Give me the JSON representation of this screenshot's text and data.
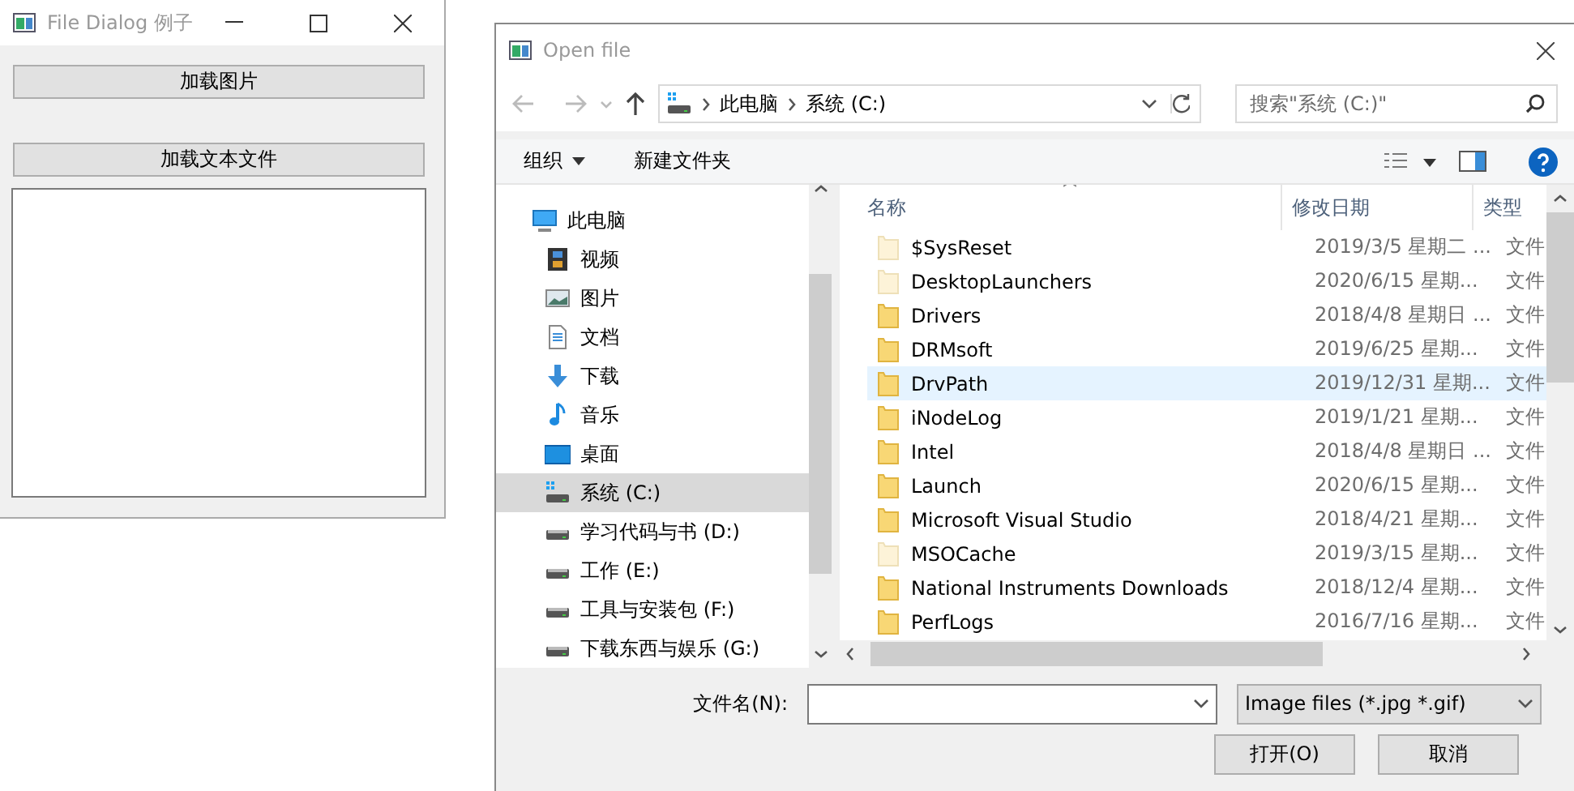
{
  "main_window": {
    "title": "File Dialog 例子",
    "buttons": [
      "加载图片",
      "加载文本文件"
    ]
  },
  "dialog": {
    "title": "Open file",
    "breadcrumb": [
      "此电脑",
      "系统 (C:)"
    ],
    "search": {
      "placeholder": "搜索\"系统 (C:)\""
    },
    "toolbar": [
      "组织",
      "新建文件夹"
    ],
    "tree": [
      {
        "label": "此电脑",
        "kind": "computer",
        "selected": false,
        "children": [
          {
            "label": "视频",
            "kind": "video",
            "selected": false
          },
          {
            "label": "图片",
            "kind": "picture",
            "selected": false
          },
          {
            "label": "文档",
            "kind": "document",
            "selected": false
          },
          {
            "label": "下载",
            "kind": "download",
            "selected": false
          },
          {
            "label": "音乐",
            "kind": "music",
            "selected": false
          },
          {
            "label": "桌面",
            "kind": "desktop",
            "selected": false
          },
          {
            "label": "系统 (C:)",
            "kind": "system-drive",
            "selected": true
          },
          {
            "label": "学习代码与书 (D:)",
            "kind": "drive",
            "selected": false
          },
          {
            "label": "工作 (E:)",
            "kind": "drive",
            "selected": false
          },
          {
            "label": "工具与安装包 (F:)",
            "kind": "drive",
            "selected": false
          },
          {
            "label": "下载东西与娱乐 (G:)",
            "kind": "drive",
            "selected": false
          }
        ]
      }
    ],
    "columns": [
      "名称",
      "修改日期",
      "类型"
    ],
    "files": [
      {
        "name": "$SysReset",
        "date": "2019/3/5 星期二 ...",
        "type": "文件",
        "hidden": true,
        "selected": false
      },
      {
        "name": "DesktopLaunchers",
        "date": "2020/6/15 星期...",
        "type": "文件",
        "hidden": true,
        "selected": false
      },
      {
        "name": "Drivers",
        "date": "2018/4/8 星期日 ...",
        "type": "文件",
        "hidden": false,
        "selected": false
      },
      {
        "name": "DRMsoft",
        "date": "2019/6/25 星期...",
        "type": "文件",
        "hidden": false,
        "selected": false
      },
      {
        "name": "DrvPath",
        "date": "2019/12/31 星期...",
        "type": "文件",
        "hidden": false,
        "selected": true
      },
      {
        "name": "iNodeLog",
        "date": "2019/1/21 星期...",
        "type": "文件",
        "hidden": false,
        "selected": false
      },
      {
        "name": "Intel",
        "date": "2018/4/8 星期日 ...",
        "type": "文件",
        "hidden": false,
        "selected": false
      },
      {
        "name": "Launch",
        "date": "2020/6/15 星期...",
        "type": "文件",
        "hidden": false,
        "selected": false
      },
      {
        "name": "Microsoft Visual Studio",
        "date": "2018/4/21 星期...",
        "type": "文件",
        "hidden": false,
        "selected": false
      },
      {
        "name": "MSOCache",
        "date": "2019/3/15 星期...",
        "type": "文件",
        "hidden": true,
        "selected": false
      },
      {
        "name": "National Instruments Downloads",
        "date": "2018/12/4 星期...",
        "type": "文件",
        "hidden": false,
        "selected": false
      },
      {
        "name": "PerfLogs",
        "date": "2016/7/16 星期...",
        "type": "文件",
        "hidden": false,
        "selected": false
      }
    ],
    "filename_label": "文件名(N):",
    "filter": "Image files (*.jpg *.gif)",
    "buttons": [
      "打开(O)",
      "取消"
    ]
  }
}
